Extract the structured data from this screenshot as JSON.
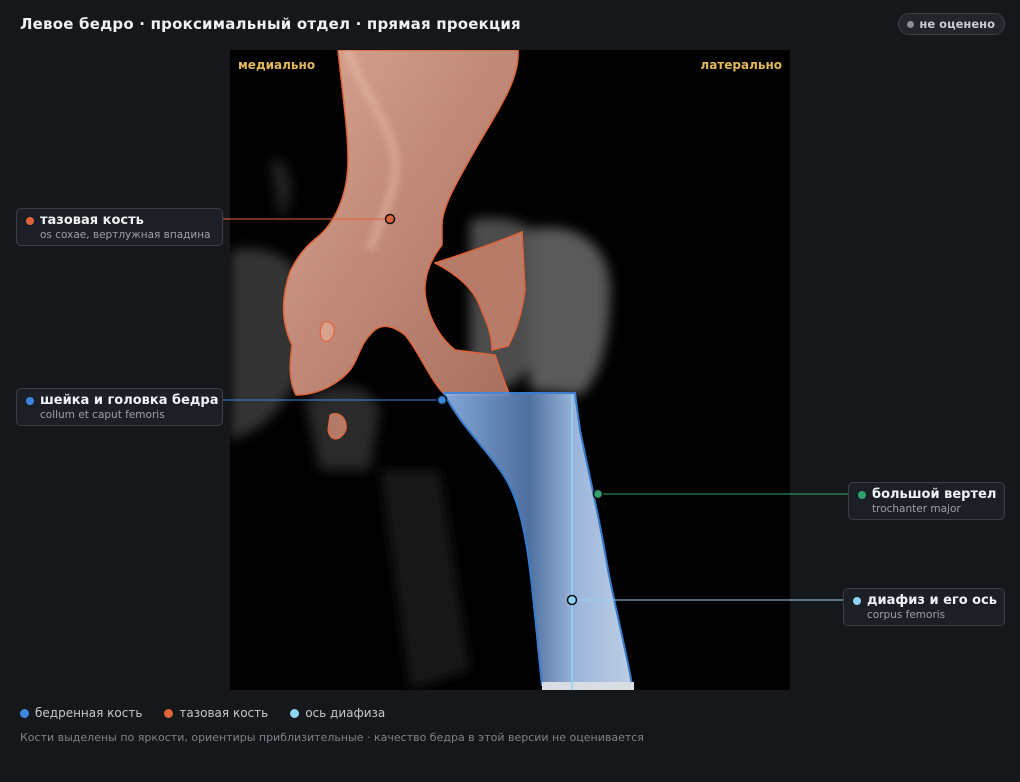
{
  "header": {
    "title": "Левое бедро · проксимальный отдел · прямая проекция",
    "status_label": "не оценено"
  },
  "image": {
    "orientation_left": "медиально",
    "orientation_right": "латерально"
  },
  "callouts": [
    {
      "key": "pelvis",
      "label": "тазовая кость",
      "sublabel": "os coxae, вертлужная впадина",
      "color": "#e0643a"
    },
    {
      "key": "neck",
      "label": "шейка и головка бедра",
      "sublabel": "collum et caput femoris",
      "color": "#3d86e0"
    },
    {
      "key": "trochanter",
      "label": "большой вертел",
      "sublabel": "trochanter major",
      "color": "#2fa46e"
    },
    {
      "key": "shaft",
      "label": "диафиз и его ось",
      "sublabel": "corpus femoris",
      "color": "#8fd3f5"
    }
  ],
  "legend": [
    {
      "label": "бедренная кость",
      "color": "#3d86e0"
    },
    {
      "label": "тазовая кость",
      "color": "#e0643a"
    },
    {
      "label": "ось диафиза",
      "color": "#8fd3f5"
    }
  ],
  "footnote": "Кости выделены по яркости, ориентиры приблизительные · качество бедра в этой версии не оценивается"
}
